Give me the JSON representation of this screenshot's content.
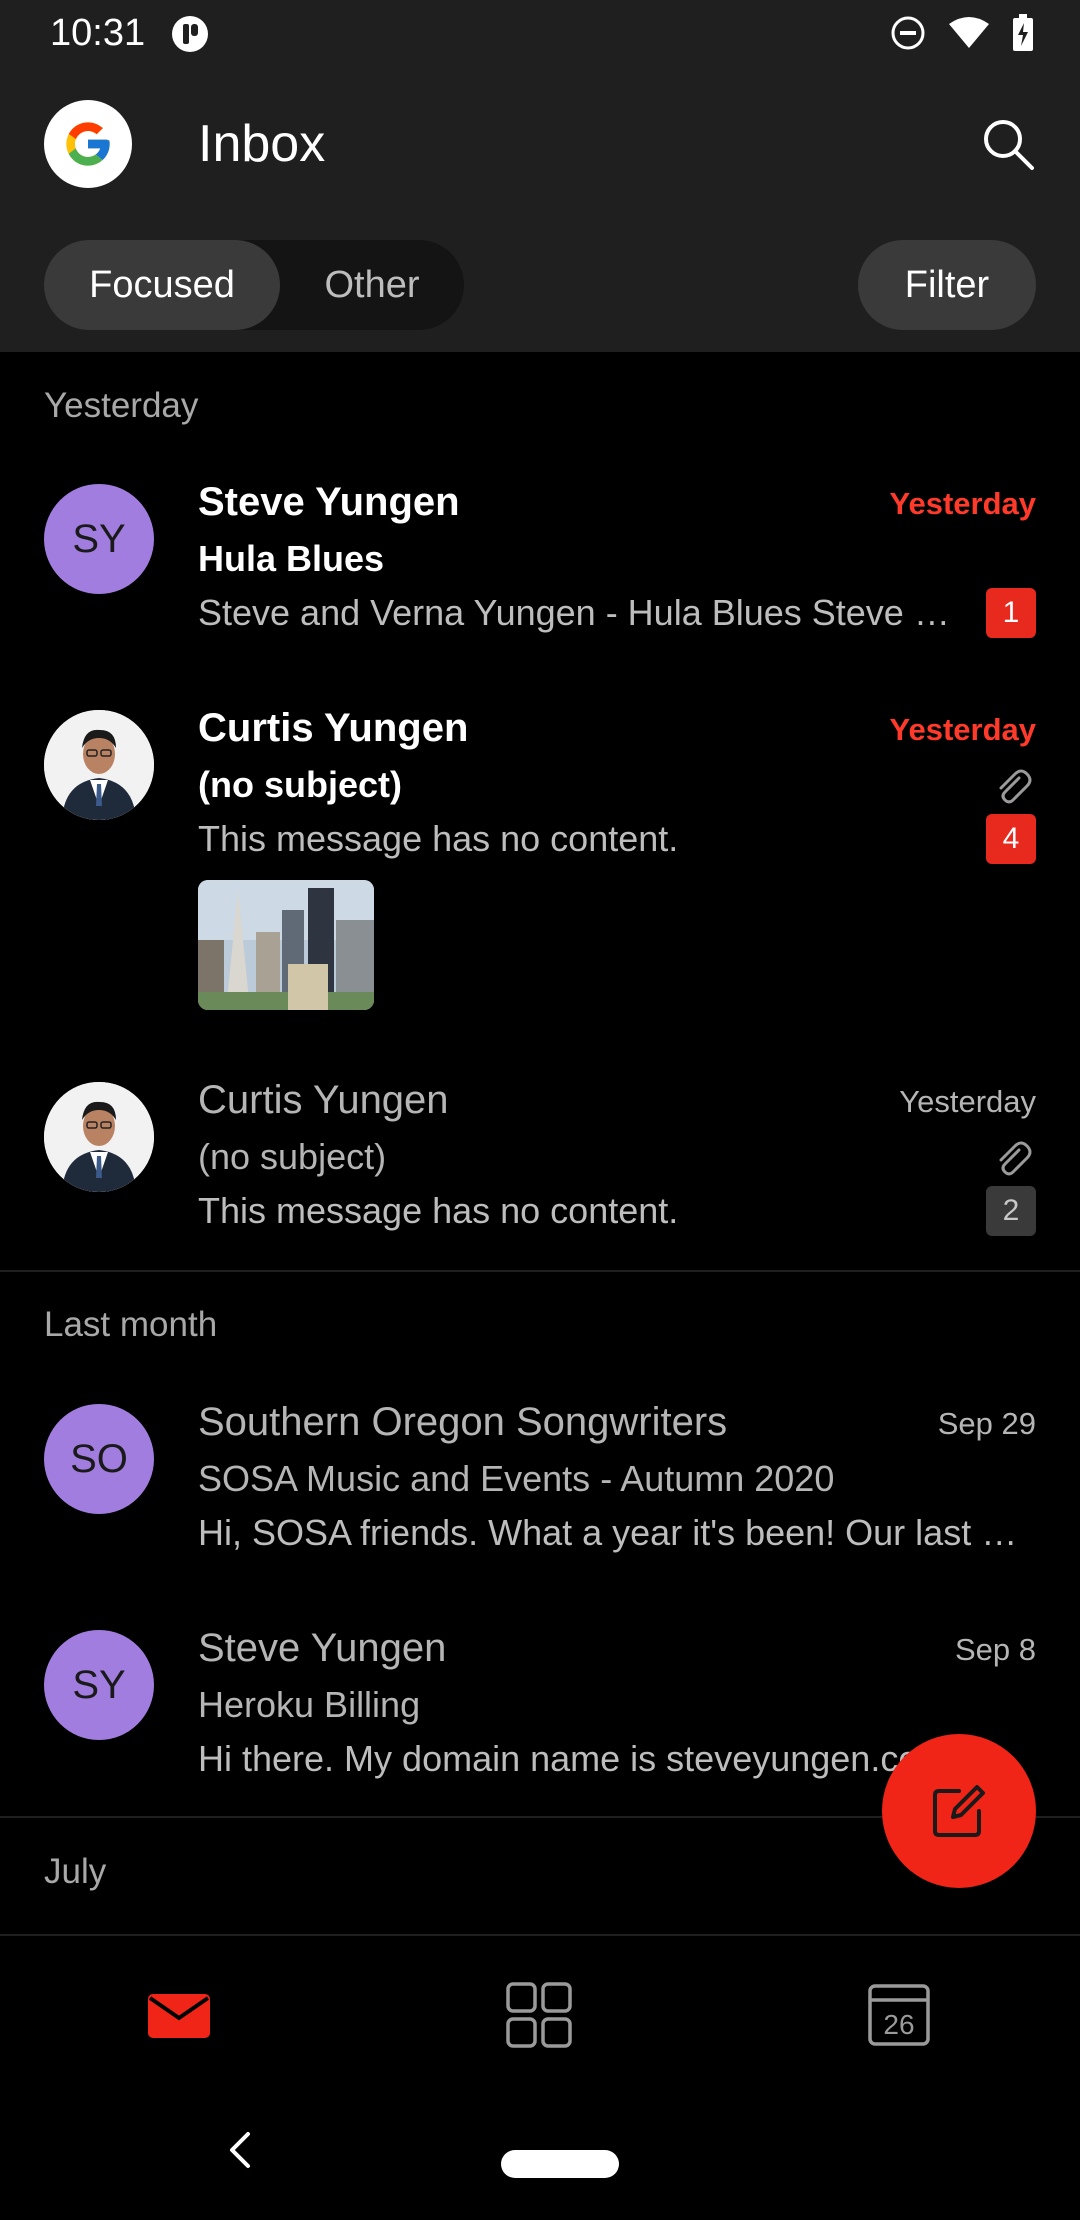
{
  "status_bar": {
    "time": "10:31"
  },
  "header": {
    "title": "Inbox"
  },
  "tabs": {
    "focused": "Focused",
    "other": "Other",
    "filter": "Filter"
  },
  "sections": {
    "yesterday": "Yesterday",
    "last_month": "Last month",
    "july": "July"
  },
  "emails": [
    {
      "initials": "SY",
      "sender": "Steve Yungen",
      "subject": "Hula Blues",
      "preview": "Steve and Verna Yungen - Hula Blues Steve and Verna Yungen",
      "date": "Yesterday",
      "count": "1",
      "unread": true,
      "attachment": false
    },
    {
      "initials": "",
      "sender": "Curtis Yungen",
      "subject": "(no subject)",
      "preview": "This message has no content.",
      "date": "Yesterday",
      "count": "4",
      "unread": true,
      "attachment": true
    },
    {
      "initials": "",
      "sender": "Curtis Yungen",
      "subject": "(no subject)",
      "preview": "This message has no content.",
      "date": "Yesterday",
      "count": "2",
      "unread": false,
      "attachment": true
    },
    {
      "initials": "SO",
      "sender": "Southern Oregon Songwriters",
      "subject": "SOSA Music and Events - Autumn 2020",
      "preview": "Hi, SOSA friends. What a year it's been! Our last newsletter",
      "date": "Sep 29",
      "unread": false,
      "attachment": false
    },
    {
      "initials": "SY",
      "sender": "Steve Yungen",
      "subject": "Heroku Billing",
      "preview": "Hi there. My domain name is steveyungen.com",
      "date": "Sep 8",
      "unread": false,
      "attachment": false
    }
  ],
  "bottom_nav": {
    "calendar_day": "26"
  },
  "colors": {
    "accent": "#f02518",
    "avatar": "#a17de0",
    "header_bg": "#1f1f1f"
  },
  "icons": [
    "google-logo",
    "search-icon",
    "paperclip-icon",
    "compose-icon",
    "mail-icon",
    "apps-grid-icon",
    "calendar-icon",
    "back-icon",
    "home-pill"
  ]
}
